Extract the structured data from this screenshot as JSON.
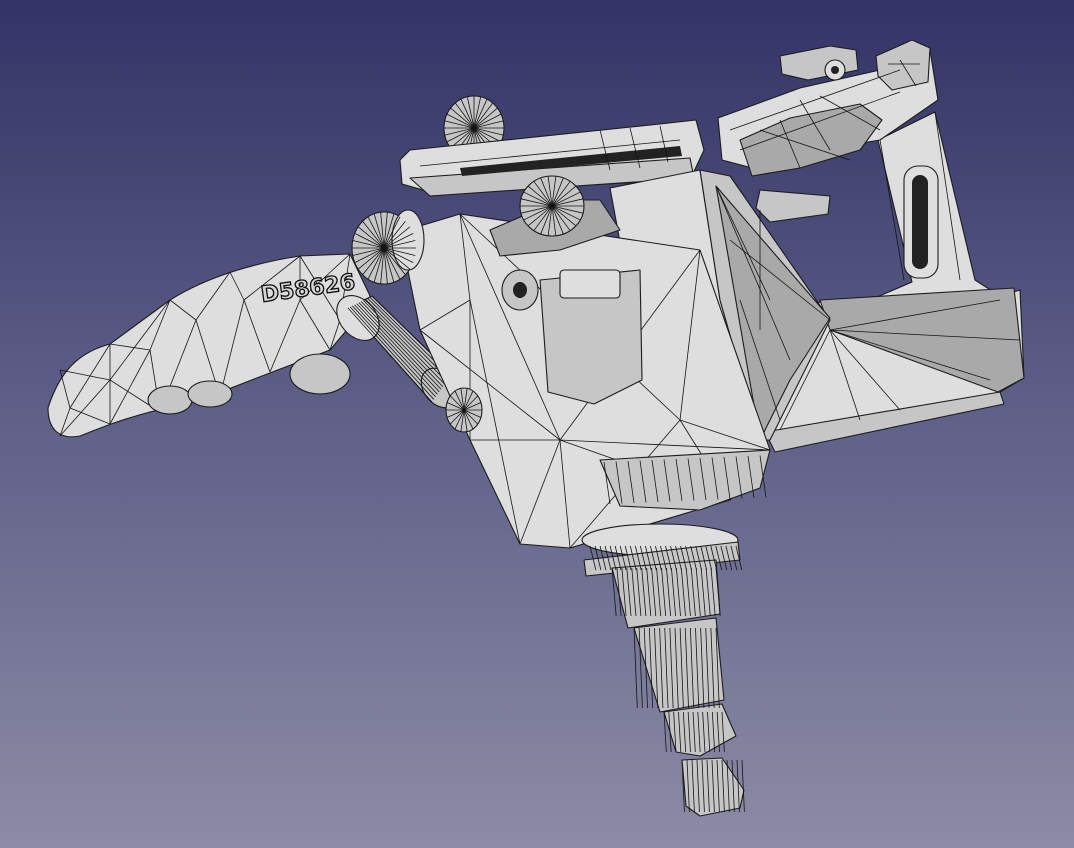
{
  "viewport": {
    "background_top": "#333366",
    "background_bottom": "#8c8ca6"
  },
  "model": {
    "part_label": "D58626",
    "display_mode": "wireframe-shaded",
    "fill_color": "#c6c6c6",
    "edge_color": "#1c1c1c"
  }
}
